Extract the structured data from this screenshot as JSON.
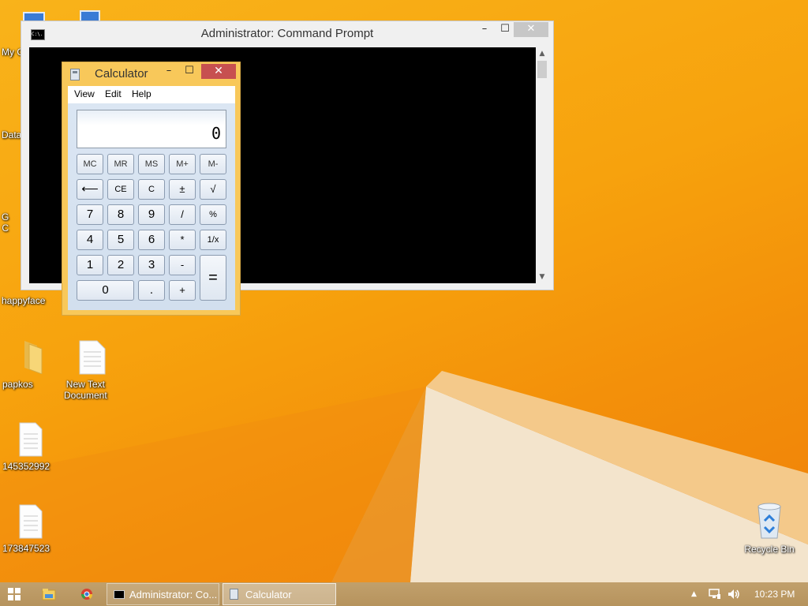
{
  "colors": {
    "accent": "#f7a20d",
    "calculator_frame": "#f8c85a",
    "close_button": "#c75050",
    "console_background": "#000000"
  },
  "desktop": {
    "icons": [
      {
        "label": "My C",
        "icon": "computer-icon"
      },
      {
        "label": "Data",
        "icon": "shortcut-icon"
      },
      {
        "label": "G\nC",
        "icon": "chrome-icon"
      },
      {
        "label": "happyface",
        "icon": "file-icon"
      },
      {
        "label": "papkos",
        "icon": "folder-icon"
      },
      {
        "label": "New Text\nDocument",
        "icon": "text-document-icon"
      },
      {
        "label": "145352992",
        "icon": "text-document-icon"
      },
      {
        "label": "173847523",
        "icon": "text-document-icon"
      },
      {
        "label": "Recycle Bin",
        "icon": "recycle-bin-icon"
      }
    ]
  },
  "cmd": {
    "title": "Administrator:  Command Prompt",
    "icon": "cmd-icon",
    "icon_text": "C:\\."
  },
  "calculator": {
    "title": "Calculator",
    "menu": [
      "View",
      "Edit",
      "Help"
    ],
    "display": "0",
    "buttons": {
      "mc": "MC",
      "mr": "MR",
      "ms": "MS",
      "mplus": "M+",
      "mminus": "M-",
      "back": "⟵",
      "ce": "CE",
      "c": "C",
      "plusminus": "±",
      "sqrt": "√",
      "seven": "7",
      "eight": "8",
      "nine": "9",
      "divide": "/",
      "percent": "%",
      "four": "4",
      "five": "5",
      "six": "6",
      "multiply": "*",
      "reciprocal": "1/x",
      "one": "1",
      "two": "2",
      "three": "3",
      "minus": "-",
      "equals": "=",
      "zero": "0",
      "decimal": ".",
      "plus": "+"
    }
  },
  "window_controls": {
    "minimize": "–",
    "maximize": "☐",
    "close": "✕"
  },
  "taskbar": {
    "buttons": [
      {
        "label": "Administrator:  Co...",
        "icon": "cmd-icon",
        "active": false
      },
      {
        "label": "Calculator",
        "icon": "calculator-icon",
        "active": true
      }
    ],
    "tray_expand": "▲",
    "clock": "10:23 PM"
  }
}
